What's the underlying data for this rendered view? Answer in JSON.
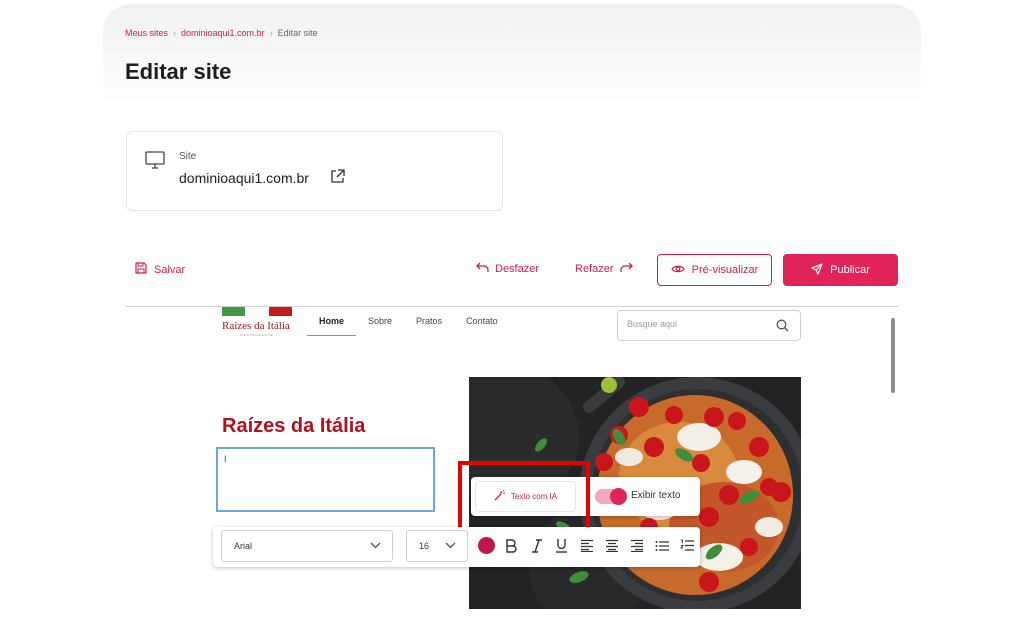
{
  "breadcrumb": {
    "items": [
      "Meus sites",
      "dominioaqui1.com.br",
      "Editar site"
    ]
  },
  "page": {
    "title": "Editar site"
  },
  "site_card": {
    "label": "Site",
    "domain": "dominioaqui1.com.br"
  },
  "toolbar": {
    "save_label": "Salvar",
    "undo_label": "Desfazer",
    "redo_label": "Refazer",
    "preview_label": "Pré-visualizar",
    "publish_label": "Publicar"
  },
  "preview_site": {
    "logo_name": "Raízes da Itália",
    "logo_sub": "RESTAURANTE",
    "nav": [
      "Home",
      "Sobre",
      "Pratos",
      "Contato"
    ],
    "search_placeholder": "Busque aqui",
    "hero_title": "Raízes da Itália",
    "textarea_value": "I"
  },
  "ai_toolbar": {
    "ai_button_label": "Texto com IA",
    "toggle_label": "Exibir texto",
    "toggle_on": true
  },
  "format_toolbar": {
    "font": "Arial",
    "size": "16",
    "text_color": "#c2174a"
  },
  "colors": {
    "accent": "#e0245a",
    "brand_red": "#b3111c",
    "flag_green": "#3f9a43",
    "flag_red": "#c9171e",
    "focus_border": "#6ba7db",
    "highlight_box": "#e60000"
  }
}
